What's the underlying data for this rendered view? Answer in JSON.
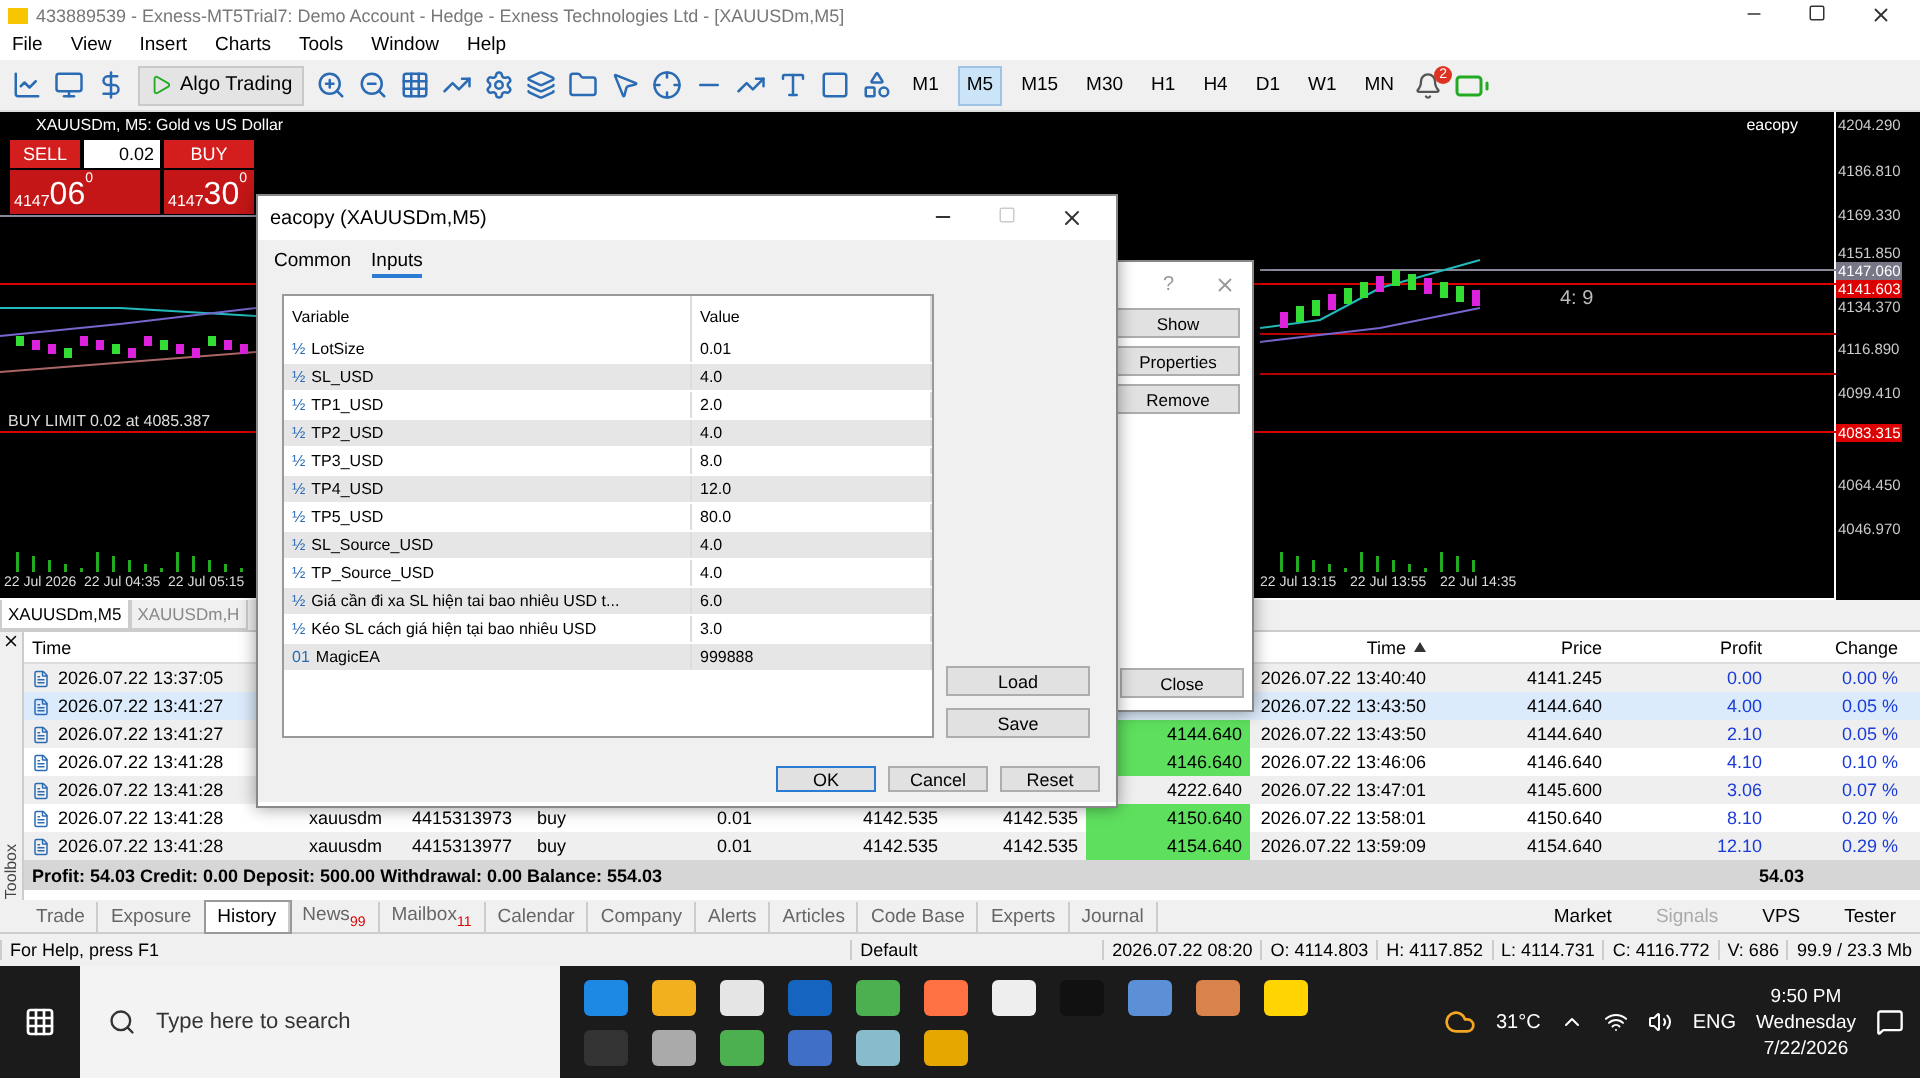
{
  "window": {
    "title": "433889539 - Exness-MT5Trial7: Demo Account - Hedge - Exness Technologies Ltd - [XAUUSDm,M5]"
  },
  "menu": [
    "File",
    "View",
    "Insert",
    "Charts",
    "Tools",
    "Window",
    "Help"
  ],
  "toolbar": {
    "algo_trading": "Algo Trading",
    "timeframes": [
      {
        "label": "M1",
        "selected": false
      },
      {
        "label": "M5",
        "selected": true
      },
      {
        "label": "M15",
        "selected": false
      },
      {
        "label": "M30",
        "selected": false
      },
      {
        "label": "H1",
        "selected": false
      },
      {
        "label": "H4",
        "selected": false
      },
      {
        "label": "D1",
        "selected": false
      },
      {
        "label": "W1",
        "selected": false
      },
      {
        "label": "MN",
        "selected": false
      }
    ],
    "notification_count": "2"
  },
  "chart": {
    "title": "XAUUSDm, M5:  Gold vs US Dollar",
    "expert": "eacopy",
    "one_click": {
      "sell": "SELL",
      "buy": "BUY",
      "volume": "0.02",
      "sell_big": "4147",
      "sell_pips": "06",
      "sell_sup": "0",
      "buy_big": "4147",
      "buy_pips": "30",
      "buy_sup": "0"
    },
    "order_label": "BUY LIMIT 0.02 at 4085.387",
    "ratio_label": "4: 9",
    "price_labels": [
      {
        "text": "4204.290",
        "kind": "plain"
      },
      {
        "text": "4186.810",
        "kind": "plain"
      },
      {
        "text": "4169.330",
        "kind": "plain"
      },
      {
        "text": "4151.850",
        "kind": "plain"
      },
      {
        "text": "4147.060",
        "kind": "grey"
      },
      {
        "text": "4141.603",
        "kind": "red"
      },
      {
        "text": "4134.370",
        "kind": "plain"
      },
      {
        "text": "4116.890",
        "kind": "plain"
      },
      {
        "text": "4099.410",
        "kind": "plain"
      },
      {
        "text": "4083.315",
        "kind": "red"
      },
      {
        "text": "4064.450",
        "kind": "plain"
      },
      {
        "text": "4046.970",
        "kind": "plain"
      }
    ],
    "time_labels": [
      "22 Jul 2026",
      "22 Jul 04:35",
      "22 Jul 05:15",
      "22 Jul 13:15",
      "22 Jul 13:55",
      "22 Jul 14:35"
    ],
    "tabs": [
      {
        "label": "XAUUSDm,M5",
        "selected": true
      },
      {
        "label": "XAUUSDm,H",
        "selected": false
      }
    ]
  },
  "history": {
    "columns": [
      "Time",
      "Time",
      "Price",
      "Profit",
      "Change"
    ],
    "rows": [
      {
        "selected": false,
        "time": "2026.07.22 13:37:05",
        "close_time": "2026.07.22 13:40:40",
        "close_price": "4141.245",
        "profit": "0.00",
        "change": "0.00 %"
      },
      {
        "selected": true,
        "time": "2026.07.22 13:41:27",
        "close_time": "2026.07.22 13:43:50",
        "close_price": "4144.640",
        "profit": "4.00",
        "change": "0.05 %"
      },
      {
        "selected": false,
        "time": "2026.07.22 13:41:27",
        "tp": "4144.640",
        "tp_hit": true,
        "close_time": "2026.07.22 13:43:50",
        "close_price": "4144.640",
        "profit": "2.10",
        "change": "0.05 %"
      },
      {
        "selected": false,
        "time": "2026.07.22 13:41:28",
        "tp": "4146.640",
        "tp_hit": true,
        "close_time": "2026.07.22 13:46:06",
        "close_price": "4146.640",
        "profit": "4.10",
        "change": "0.10 %"
      },
      {
        "selected": false,
        "time": "2026.07.22 13:41:28",
        "tp": "4222.640",
        "tp_hit": false,
        "close_time": "2026.07.22 13:47:01",
        "close_price": "4145.600",
        "profit": "3.06",
        "change": "0.07 %"
      },
      {
        "selected": false,
        "time": "2026.07.22 13:41:28",
        "symbol": "xauusdm",
        "ticket": "4415313973",
        "type": "buy",
        "volume": "0.01",
        "price": "4142.535",
        "sl": "4142.535",
        "tp": "4150.640",
        "tp_hit": true,
        "close_time": "2026.07.22 13:58:01",
        "close_price": "4150.640",
        "profit": "8.10",
        "change": "0.20 %"
      },
      {
        "selected": false,
        "time": "2026.07.22 13:41:28",
        "symbol": "xauusdm",
        "ticket": "4415313977",
        "type": "buy",
        "volume": "0.01",
        "price": "4142.535",
        "sl": "4142.535",
        "tp": "4154.640",
        "tp_hit": true,
        "close_time": "2026.07.22 13:59:09",
        "close_price": "4154.640",
        "profit": "12.10",
        "change": "0.29 %"
      }
    ],
    "summary": "Profit: 54.03  Credit: 0.00  Deposit: 500.00  Withdrawal: 0.00  Balance: 554.03",
    "summary_profit": "54.03"
  },
  "toolbox": {
    "label": "Toolbox",
    "tabs": [
      {
        "label": "Trade",
        "selected": false
      },
      {
        "label": "Exposure",
        "selected": false
      },
      {
        "label": "History",
        "selected": true
      },
      {
        "label": "News",
        "badge": "99",
        "selected": false
      },
      {
        "label": "Mailbox",
        "badge": "11",
        "selected": false
      },
      {
        "label": "Calendar",
        "selected": false
      },
      {
        "label": "Company",
        "selected": false
      },
      {
        "label": "Alerts",
        "selected": false
      },
      {
        "label": "Articles",
        "selected": false
      },
      {
        "label": "Code Base",
        "selected": false
      },
      {
        "label": "Experts",
        "selected": false
      },
      {
        "label": "Journal",
        "selected": false
      }
    ],
    "links": [
      {
        "label": "Market",
        "disabled": false
      },
      {
        "label": "Signals",
        "disabled": true
      },
      {
        "label": "VPS",
        "disabled": false
      },
      {
        "label": "Tester",
        "disabled": false
      }
    ]
  },
  "status_bar": {
    "help": "For Help, press F1",
    "profile": "Default",
    "fields": [
      "2026.07.22 08:20",
      "O: 4114.803",
      "H: 4117.852",
      "L: 4114.731",
      "C: 4116.772",
      "V: 686"
    ],
    "traffic": "99.9 / 23.3 Mb"
  },
  "ea_dialog": {
    "title": "eacopy (XAUUSDm,M5)",
    "tabs": [
      {
        "label": "Common",
        "selected": false
      },
      {
        "label": "Inputs",
        "selected": true
      }
    ],
    "columns": [
      "Variable",
      "Value"
    ],
    "inputs": [
      {
        "icon": "½",
        "name": "LotSize",
        "value": "0.01"
      },
      {
        "icon": "½",
        "name": "SL_USD",
        "value": "4.0"
      },
      {
        "icon": "½",
        "name": "TP1_USD",
        "value": "2.0"
      },
      {
        "icon": "½",
        "name": "TP2_USD",
        "value": "4.0"
      },
      {
        "icon": "½",
        "name": "TP3_USD",
        "value": "8.0"
      },
      {
        "icon": "½",
        "name": "TP4_USD",
        "value": "12.0"
      },
      {
        "icon": "½",
        "name": "TP5_USD",
        "value": "80.0"
      },
      {
        "icon": "½",
        "name": "SL_Source_USD",
        "value": "4.0"
      },
      {
        "icon": "½",
        "name": "TP_Source_USD",
        "value": "4.0"
      },
      {
        "icon": "½",
        "name": "Giá cần đi xa SL hiện tai bao nhiêu USD t...",
        "value": "6.0"
      },
      {
        "icon": "½",
        "name": "Kéo SL cách giá hiện tại bao nhiêu USD",
        "value": "3.0"
      },
      {
        "icon": "01",
        "name": "MagicEA",
        "value": "999888"
      }
    ],
    "side_buttons": [
      "Load",
      "Save"
    ],
    "buttons": [
      {
        "label": "OK",
        "default": true
      },
      {
        "label": "Cancel",
        "default": false
      },
      {
        "label": "Reset",
        "default": false
      }
    ]
  },
  "indicator_dialog": {
    "help": "?",
    "buttons": [
      "Show",
      "Properties",
      "Remove"
    ],
    "close": "Close"
  },
  "taskbar": {
    "search_placeholder": "Type here to search",
    "weather": "31°C",
    "language": "ENG",
    "time": "9:50 PM",
    "day": "Wednesday",
    "date": "7/22/2026"
  }
}
